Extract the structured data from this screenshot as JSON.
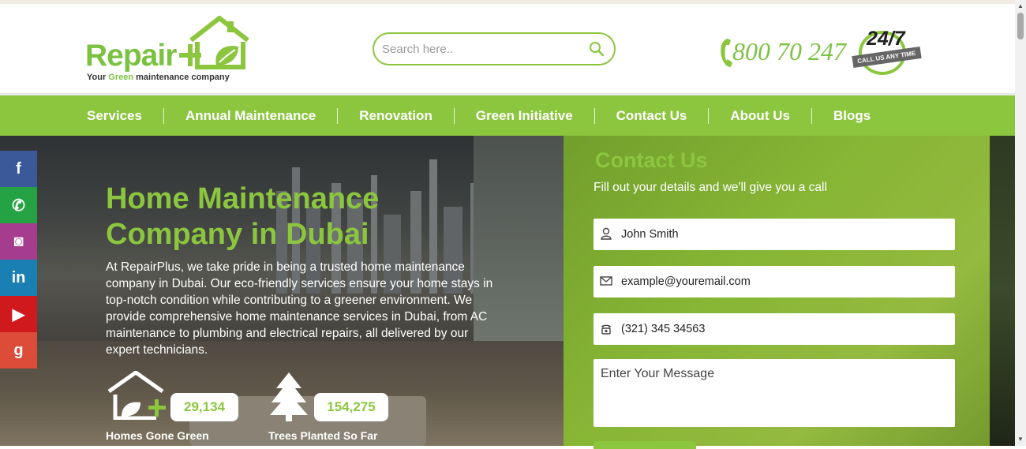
{
  "logo": {
    "word": "Repair",
    "tagline_prefix": "Your ",
    "tagline_green": "Green",
    "tagline_suffix": " maintenance company"
  },
  "search": {
    "placeholder": "Search here..",
    "icon": "search-icon"
  },
  "phone": {
    "number": "800 70 247",
    "badge": "24/7",
    "badge_ribbon": "CALL US ANY TIME",
    "icon": "phone-icon"
  },
  "nav": {
    "items": [
      "Services",
      "Annual Maintenance",
      "Renovation",
      "Green Initiative",
      "Contact Us",
      "About Us",
      "Blogs"
    ]
  },
  "social": [
    {
      "name": "facebook",
      "glyph": "f",
      "color": "#3b5998"
    },
    {
      "name": "whatsapp",
      "glyph": "✆",
      "color": "#25a244"
    },
    {
      "name": "instagram",
      "glyph": "◙",
      "color": "#a63c8e"
    },
    {
      "name": "linkedin",
      "glyph": "in",
      "color": "#1a7fb3"
    },
    {
      "name": "youtube",
      "glyph": "▶",
      "color": "#d0191d"
    },
    {
      "name": "google",
      "glyph": "g",
      "color": "#dd4b39"
    }
  ],
  "hero": {
    "title": "Home Maintenance Company in Dubai",
    "text": "At RepairPlus, we take pride in being a trusted home maintenance company in Dubai. Our eco-friendly services ensure your home stays in top-notch condition while contributing to a greener environment. We provide comprehensive home maintenance services in Dubai, from AC maintenance to plumbing and electrical repairs, all delivered by our expert technicians.",
    "stats": [
      {
        "value": "29,134",
        "caption": "Homes Gone Green",
        "icon": "green-home-icon"
      },
      {
        "value": "154,275",
        "caption": "Trees Planted So Far",
        "icon": "tree-icon"
      }
    ]
  },
  "contact_form": {
    "heading": "Contact Us",
    "subheading": "Fill out your details and we'll give you a call",
    "name_value": "John Smith",
    "email_value": "example@youremail.com",
    "phone_value": "(321) 345 34563",
    "message_placeholder": "Enter Your Message"
  },
  "colors": {
    "brand_green": "#8cc63f",
    "text_dark": "#333333"
  }
}
